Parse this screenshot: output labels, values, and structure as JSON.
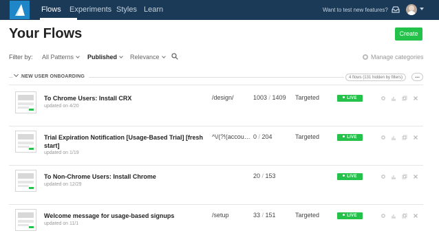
{
  "nav": {
    "items": [
      "Flows",
      "Experiments",
      "Styles",
      "Learn"
    ],
    "test_text": "Want to test new features?"
  },
  "header": {
    "title": "Your Flows",
    "create_label": "Create"
  },
  "filters": {
    "label": "Filter by:",
    "patterns": "All Patterns",
    "status": "Published",
    "sort": "Relevance",
    "manage": "Manage categories"
  },
  "group": {
    "name": "NEW USER ONBOARDING",
    "count": "4 flows (131 hidden by filters)",
    "more": "..."
  },
  "live_label": "LIVE",
  "rows": [
    {
      "title": "To Chrome Users: Install CRX",
      "updated": "updated on 4/20",
      "path": "/design/",
      "views": "1003",
      "total": "1409",
      "target": "Targeted"
    },
    {
      "title": "Trial Expiration Notification [Usage-Based Trial] [fresh start]",
      "updated": "updated on 1/19",
      "path": "^\\/(?!(account...",
      "views": "0",
      "total": "204",
      "target": "Targeted"
    },
    {
      "title": "To Non-Chrome Users: Install Chrome",
      "updated": "updated on 12/29",
      "path": "",
      "views": "20",
      "total": "153",
      "target": ""
    },
    {
      "title": "Welcome message for usage-based signups",
      "updated": "updated on 11/1",
      "path": "/setup",
      "views": "33",
      "total": "151",
      "target": "Targeted"
    }
  ],
  "colors": {
    "nav_bg": "#1b3a57",
    "accent_green": "#25c24b",
    "logo_blue": "#1f86c8"
  }
}
